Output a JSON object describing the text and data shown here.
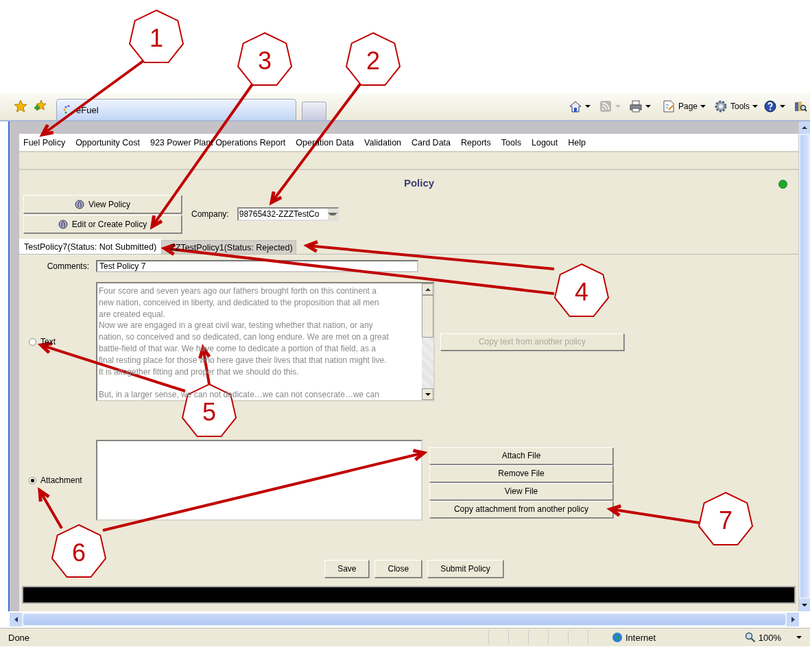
{
  "browser": {
    "tab_title": "eFuel",
    "commands": [
      {
        "kind": "home"
      },
      {
        "kind": "feed"
      },
      {
        "kind": "print"
      },
      {
        "kind": "page",
        "label": "Page"
      },
      {
        "kind": "tools",
        "label": "Tools"
      },
      {
        "kind": "help"
      },
      {
        "kind": "research"
      }
    ]
  },
  "menu": [
    "Fuel Policy",
    "Opportunity Cost",
    "923 Power Plant Operations Report",
    "Operation Data",
    "Validation",
    "Card Data",
    "Reports",
    "Tools",
    "Logout",
    "Help"
  ],
  "page": {
    "title": "Policy",
    "actions": [
      "View Policy",
      "Edit or Create Policy"
    ],
    "company": {
      "label": "Company:",
      "value": "98765432-ZZZTestCo"
    },
    "tabs": [
      {
        "label": "TestPolicy7(Status: Not Submitted)",
        "selected": true
      },
      {
        "label": "ZZTestPolicy1(Status: Rejected)",
        "selected": false
      }
    ],
    "comments": {
      "label": "Comments:",
      "value": "Test Policy 7"
    },
    "modes": [
      {
        "kind": "text",
        "label": "Text",
        "selected": false,
        "button": {
          "label": "Copy text from another policy",
          "disabled": true
        },
        "paragraphs": [
          [
            "Four score and seven years ago our fathers brought forth on this continent a",
            "new nation, conceived in liberty, and dedicated to the proposition that all men",
            "are created equal.",
            "Now we are engaged in a great civil war, testing whether that nation, or any",
            "nation, so conceived and so dedicated, can long endure. We are met on a great",
            "battle-field of that war. We have come to dedicate a portion of that field, as a",
            "final resting place for those who here gave their lives that that nation might live.",
            "It is altogether fitting and proper that we should do this."
          ],
          [
            "But, in a larger sense, we can not dedicate…we can not consecrate…we can"
          ]
        ]
      },
      {
        "kind": "attachment",
        "label": "Attachment",
        "selected": true,
        "buttons": [
          {
            "label": "Attach File",
            "disabled": false
          },
          {
            "label": "Remove File",
            "disabled": false
          },
          {
            "label": "View File",
            "disabled": false
          },
          {
            "label": "Copy attachment from another policy",
            "disabled": false
          }
        ]
      }
    ],
    "footer_buttons": [
      "Save",
      "Close",
      "Submit Policy"
    ]
  },
  "status_bar": {
    "text": "Done",
    "zone": "Internet",
    "zoom": "100%"
  },
  "callouts": [
    "1",
    "3",
    "2",
    "4",
    "5",
    "6",
    "7"
  ]
}
